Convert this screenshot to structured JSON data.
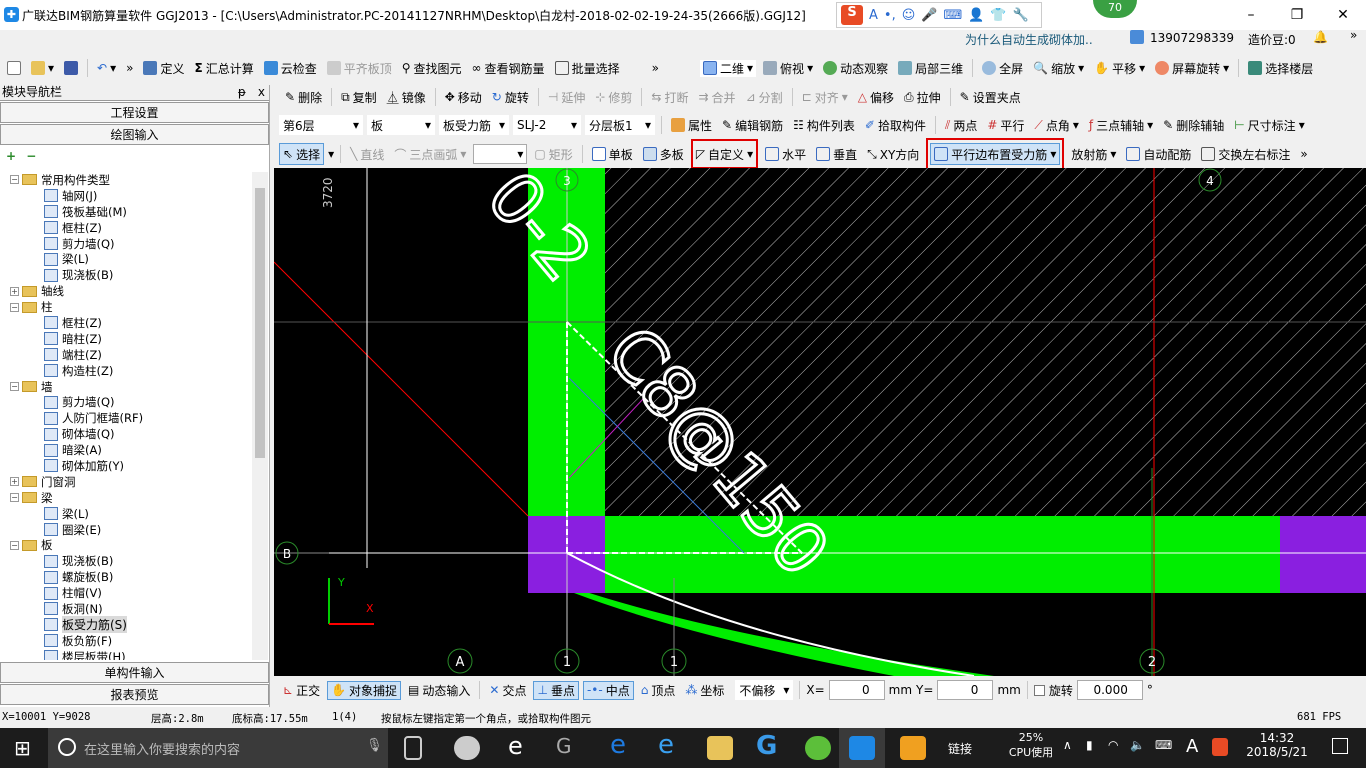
{
  "window": {
    "title": "广联达BIM钢筋算量软件 GGJ2013 - [C:\\Users\\Administrator.PC-20141127NRHM\\Desktop\\白龙村-2018-02-02-19-24-35(2666版).GGJ12]",
    "app_icon": "app-icon",
    "minimize": "–",
    "maximize": "❐",
    "close": "✕",
    "badge": "70"
  },
  "ime": {
    "logo": "S",
    "items": [
      "A",
      "•,",
      "☺",
      "🎤",
      "⌨",
      "👤",
      "👕",
      "🔧"
    ]
  },
  "info": {
    "question": "为什么自动生成砌体加..",
    "user": "13907298339",
    "beans": "造价豆:0",
    "more": "»"
  },
  "toolbar_main": {
    "define": "定义",
    "sum": "汇总计算",
    "cloud": "云检查",
    "align_top": "平齐板顶",
    "find": "查找图元",
    "view_rebar": "查看钢筋量",
    "batch": "批量选择",
    "more": "»"
  },
  "toolbar_view": {
    "view2d": "二维",
    "top": "俯视",
    "orbit": "动态观察",
    "local3d": "局部三维",
    "full": "全屏",
    "zoom": "缩放",
    "pan": "平移",
    "rotate": "屏幕旋转",
    "floor": "选择楼层",
    "more": "»"
  },
  "toolbar_edit": {
    "delete": "删除",
    "copy": "复制",
    "mirror": "镜像",
    "move": "移动",
    "rotate": "旋转",
    "extend": "延伸",
    "trim": "修剪",
    "break": "打断",
    "merge": "合并",
    "split": "分割",
    "align": "对齐",
    "offset": "偏移",
    "stretch": "拉伸",
    "grip": "设置夹点"
  },
  "toolbar_props": {
    "floor": "第6层",
    "type": "板",
    "subtype": "板受力筋",
    "name": "SLJ-2",
    "layer": "分层板1",
    "attr": "属性",
    "edit_rebar": "编辑钢筋",
    "list": "构件列表",
    "pick": "拾取构件",
    "two_point": "两点",
    "parallel": "平行",
    "point_angle": "点角",
    "three_point_axis": "三点辅轴",
    "del_axis": "删除辅轴",
    "dim": "尺寸标注"
  },
  "toolbar_draw": {
    "select": "选择",
    "line": "直线",
    "arc": "三点画弧",
    "rect": "矩形",
    "single": "单板",
    "multi": "多板",
    "custom": "自定义",
    "horizontal": "水平",
    "vertical": "垂直",
    "xy": "XY方向",
    "parallel_edge": "平行边布置受力筋",
    "radial": "放射筋",
    "auto": "自动配筋",
    "swap": "交换左右标注",
    "more": "»"
  },
  "nav": {
    "title": "模块导航栏",
    "pin": "ᵽ",
    "close": "x",
    "project": "工程设置",
    "draw_input": "绘图输入",
    "single_input": "单构件输入",
    "report": "报表预览",
    "add": "+",
    "remove": "−",
    "tree": [
      {
        "l": 0,
        "t": "f",
        "exp": "−",
        "label": "常用构件类型"
      },
      {
        "l": 1,
        "t": "c",
        "label": "轴网(J)"
      },
      {
        "l": 1,
        "t": "c",
        "label": "筏板基础(M)"
      },
      {
        "l": 1,
        "t": "c",
        "label": "框柱(Z)"
      },
      {
        "l": 1,
        "t": "c",
        "label": "剪力墙(Q)"
      },
      {
        "l": 1,
        "t": "c",
        "label": "梁(L)"
      },
      {
        "l": 1,
        "t": "c",
        "label": "现浇板(B)"
      },
      {
        "l": 0,
        "t": "f",
        "exp": "+",
        "label": "轴线"
      },
      {
        "l": 0,
        "t": "f",
        "exp": "−",
        "label": "柱"
      },
      {
        "l": 1,
        "t": "c",
        "label": "框柱(Z)"
      },
      {
        "l": 1,
        "t": "c",
        "label": "暗柱(Z)"
      },
      {
        "l": 1,
        "t": "c",
        "label": "端柱(Z)"
      },
      {
        "l": 1,
        "t": "c",
        "label": "构造柱(Z)"
      },
      {
        "l": 0,
        "t": "f",
        "exp": "−",
        "label": "墙"
      },
      {
        "l": 1,
        "t": "c",
        "label": "剪力墙(Q)"
      },
      {
        "l": 1,
        "t": "c",
        "label": "人防门框墙(RF)"
      },
      {
        "l": 1,
        "t": "c",
        "label": "砌体墙(Q)"
      },
      {
        "l": 1,
        "t": "c",
        "label": "暗梁(A)"
      },
      {
        "l": 1,
        "t": "c",
        "label": "砌体加筋(Y)"
      },
      {
        "l": 0,
        "t": "f",
        "exp": "+",
        "label": "门窗洞"
      },
      {
        "l": 0,
        "t": "f",
        "exp": "−",
        "label": "梁"
      },
      {
        "l": 1,
        "t": "c",
        "label": "梁(L)"
      },
      {
        "l": 1,
        "t": "c",
        "label": "圈梁(E)"
      },
      {
        "l": 0,
        "t": "f",
        "exp": "−",
        "label": "板"
      },
      {
        "l": 1,
        "t": "c",
        "label": "现浇板(B)"
      },
      {
        "l": 1,
        "t": "c",
        "label": "螺旋板(B)"
      },
      {
        "l": 1,
        "t": "c",
        "label": "柱帽(V)"
      },
      {
        "l": 1,
        "t": "c",
        "label": "板洞(N)"
      },
      {
        "l": 1,
        "t": "c",
        "label": "板受力筋(S)",
        "sel": true
      },
      {
        "l": 1,
        "t": "c",
        "label": "板负筋(F)"
      },
      {
        "l": 1,
        "t": "c",
        "label": "楼层板带(H)"
      }
    ]
  },
  "canvas": {
    "dim_label": "3720",
    "rebar_label": "C8@150",
    "rebar_prefix": "0-2",
    "axis": {
      "a": "A",
      "one": "1",
      "one_b": "1",
      "two": "2",
      "four": "4",
      "three": "3",
      "left": "B"
    },
    "x_axis": "X",
    "y_axis": "Y",
    "colors": {
      "slab": "#00ee00",
      "column": "#8a1fe0",
      "label": "#ff33ff",
      "red": "#ff0000"
    }
  },
  "snap": {
    "ortho": "正交",
    "snap": "对象捕捉",
    "dyn": "动态输入",
    "cross": "交点",
    "perp": "垂点",
    "mid": "中点",
    "vertex": "顶点",
    "coord": "坐标",
    "offset": "不偏移",
    "x_label": "X=",
    "x": "0",
    "mm1": "mm",
    "y_label": "Y=",
    "y": "0",
    "mm2": "mm",
    "rotate_label": "旋转",
    "rotate": "0.000",
    "deg": "°"
  },
  "status": {
    "coords": "X=10001 Y=9028",
    "floor_h": "层高:2.8m",
    "base_h": "底标高:17.55m",
    "count": "1(4)",
    "hint": "按鼠标左键指定第一个角点，或拾取构件图元",
    "fps": "681 FPS"
  },
  "taskbar": {
    "search": "在这里输入你要搜索的内容",
    "link": "链接",
    "cpu_pct": "25%",
    "cpu": "CPU使用",
    "ime_a": "A",
    "time": "14:32",
    "date": "2018/5/21"
  }
}
